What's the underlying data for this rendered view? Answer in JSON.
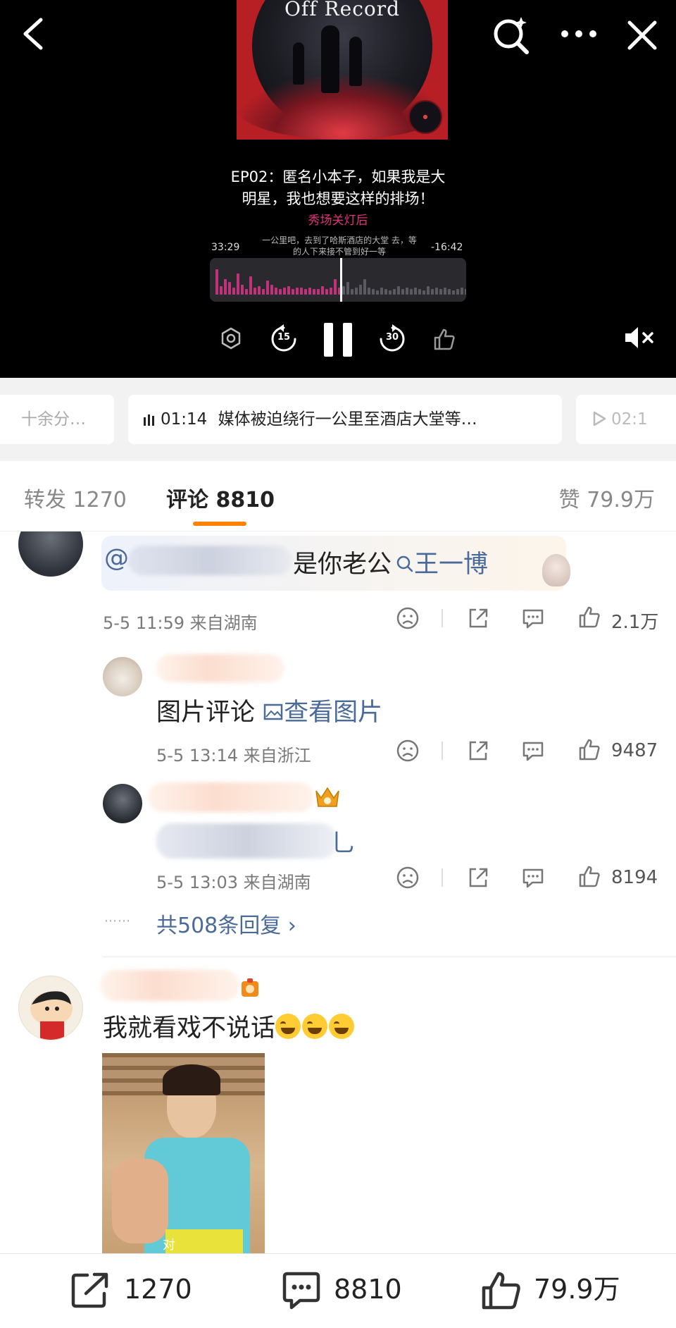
{
  "player": {
    "cover_title": "Off Record",
    "episode_title_line1": "EP02：匿名小本子，如果我是大",
    "episode_title_line2": "明星，我也想要这样的排场！",
    "show_name": "秀场关灯后",
    "elapsed": "33:29",
    "remaining": "-16:42",
    "lyric": "一公里吧，去到了哈斯酒店的大堂 去，等的人下来接不管到好一等",
    "skip_back_seconds": "15",
    "skip_forward_seconds": "30",
    "progress_fraction": 0.66
  },
  "chapters": {
    "prev_text": "十余分…",
    "active_time": "01:14",
    "active_text": "媒体被迫绕行一公里至酒店大堂等…",
    "next_time": "02:1"
  },
  "tabs": {
    "forward_label": "转发",
    "forward_count": "1270",
    "comment_label": "评论",
    "comment_count": "8810",
    "like_label": "赞",
    "like_count": "79.9万"
  },
  "comments": [
    {
      "text_prefix": "@",
      "text": "是你老公",
      "link": "王一博",
      "meta": "5-5 11:59  来自湖南",
      "likes": "2.1万",
      "replies": [
        {
          "text": "图片评论",
          "link": "查看图片",
          "meta": "5-5 13:14  来自浙江",
          "likes": "9487"
        },
        {
          "text_tail": "乚",
          "meta": "5-5 13:03  来自湖南",
          "likes": "8194"
        }
      ],
      "more_replies": "共508条回复 ›"
    },
    {
      "text": "我就看戏不说话",
      "photo_caption": "对"
    }
  ],
  "bottom_bar": {
    "forward_count": "1270",
    "comment_count": "8810",
    "like_count": "79.9万"
  },
  "colors": {
    "accent": "#ff8200",
    "link": "#4a6a99",
    "show_name": "#e0327a"
  }
}
